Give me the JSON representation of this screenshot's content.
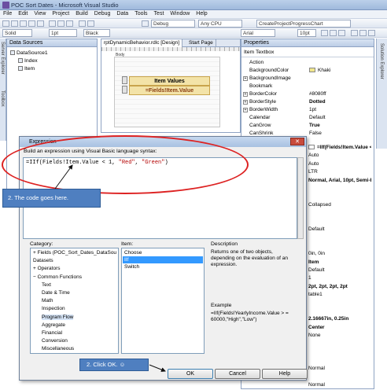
{
  "window": {
    "title": "POC Sort Dates - Microsoft Visual Studio"
  },
  "menu": [
    "File",
    "Edit",
    "View",
    "Project",
    "Build",
    "Debug",
    "Data",
    "Tools",
    "Test",
    "Window",
    "Help"
  ],
  "toolbar": {
    "config": "Debug",
    "platform": "Any CPU",
    "startup": "CreateProjectProgressChart",
    "border_style": "Solid",
    "border_width": "1pt",
    "border_color": "Black",
    "font_name": "Arial",
    "font_size": "10pt"
  },
  "data_sources": {
    "title": "Data Sources",
    "tree": [
      {
        "label": "DataSource1",
        "level": 0
      },
      {
        "label": "Index",
        "level": 1
      },
      {
        "label": "Item",
        "level": 1
      }
    ]
  },
  "side_tabs": [
    "Server Explorer",
    "Toolbox"
  ],
  "right_tabs": [
    "Solution Explorer"
  ],
  "designer": {
    "tabs": [
      "rptDynamicBehavior.rdlc [Design]",
      "Start Page"
    ],
    "body_label": "Body",
    "table_header": "Item Values",
    "table_cell": "=Fields!Item.Value"
  },
  "properties": {
    "title": "Properties",
    "object": "Item  Textbox",
    "rows": [
      {
        "name": "Action",
        "value": ""
      },
      {
        "name": "BackgroundColor",
        "value": "Khaki",
        "swatch": "#f0e68c"
      },
      {
        "name": "BackgroundImage",
        "value": "",
        "expand": true
      },
      {
        "name": "Bookmark",
        "value": ""
      },
      {
        "name": "BorderColor",
        "value": "#8080ff",
        "expand": true
      },
      {
        "name": "BorderStyle",
        "value": "Dotted",
        "expand": true,
        "bold": true
      },
      {
        "name": "BorderWidth",
        "value": "1pt",
        "expand": true
      },
      {
        "name": "Calendar",
        "value": "Default"
      },
      {
        "name": "CanGrow",
        "value": "True",
        "bold": true
      },
      {
        "name": "CanShrink",
        "value": "False"
      }
    ],
    "values_below": [
      {
        "value": "=IIf(Fields!Item.Value < 1",
        "swatch": "#ffffff",
        "bold": true
      },
      {
        "value": "Auto"
      },
      {
        "value": "Auto"
      },
      {
        "value": "LTR"
      },
      {
        "value": "Normal, Arial, 10pt, Semi-bo",
        "bold": true
      },
      {
        "value": ""
      },
      {
        "value": ""
      },
      {
        "value": "Collapsed"
      },
      {
        "value": ""
      },
      {
        "value": ""
      },
      {
        "value": "Default"
      },
      {
        "value": ""
      },
      {
        "value": ""
      },
      {
        "value": "0in, 0in"
      },
      {
        "value": "Item",
        "bold": true
      },
      {
        "value": "Default"
      },
      {
        "value": "1"
      },
      {
        "value": "2pt, 2pt, 2pt, 2pt",
        "bold": true
      },
      {
        "value": "table1"
      },
      {
        "value": ""
      },
      {
        "value": ""
      },
      {
        "value": "2.16667in, 0.25in",
        "bold": true
      },
      {
        "value": "Center",
        "bold": true
      },
      {
        "value": "None"
      },
      {
        "value": ""
      },
      {
        "value": ""
      },
      {
        "value": ""
      },
      {
        "value": "Normal"
      },
      {
        "value": ""
      },
      {
        "value": "Normal"
      }
    ]
  },
  "dialog": {
    "title": "Expression",
    "prompt": "Build an expression using Visual Basic language syntax:",
    "code": "=IIf(Fields!Item.Value < 1, \"Red\", \"Green\")",
    "category_label": "Category:",
    "item_label": "Item:",
    "description_label": "Description",
    "categories": [
      {
        "label": "Fields (POC_Sort_Dates_DataSou",
        "indent": 0,
        "expand": "+"
      },
      {
        "label": "Datasets",
        "indent": 0
      },
      {
        "label": "Operators",
        "indent": 0,
        "expand": "+"
      },
      {
        "label": "Common Functions",
        "indent": 0,
        "expand": "−"
      },
      {
        "label": "Text",
        "indent": 1
      },
      {
        "label": "Date & Time",
        "indent": 1
      },
      {
        "label": "Math",
        "indent": 1
      },
      {
        "label": "Inspection",
        "indent": 1
      },
      {
        "label": "Program Flow",
        "indent": 1,
        "selected": true
      },
      {
        "label": "Aggregate",
        "indent": 1
      },
      {
        "label": "Financial",
        "indent": 1
      },
      {
        "label": "Conversion",
        "indent": 1
      },
      {
        "label": "Miscellaneous",
        "indent": 1
      }
    ],
    "items": [
      {
        "label": "Choose"
      },
      {
        "label": "IIf",
        "selected": true
      },
      {
        "label": "Switch"
      }
    ],
    "description": "Returns one of two objects, depending on the evaluation of an expression.",
    "example_label": "Example",
    "example": "=IIf(Fields!YearlyIncome.Value > = 60000,\"High\",\"Low\")",
    "buttons": {
      "ok": "OK",
      "cancel": "Cancel",
      "help": "Help"
    }
  },
  "annotations": {
    "callout1": "2. The code goes here.",
    "callout2": "2.   Click OK. ☺",
    "ellipse_color": "#dd2222"
  }
}
